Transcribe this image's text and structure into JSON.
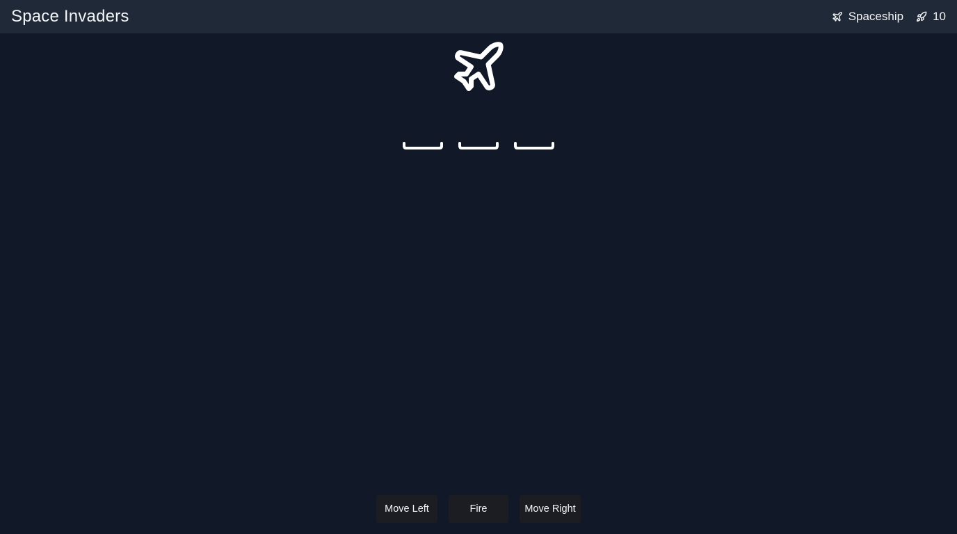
{
  "header": {
    "title": "Space Invaders",
    "ship_label": "Spaceship",
    "ship_icon": "plane-icon",
    "ammo_icon": "rocket-icon",
    "ammo_count": "10"
  },
  "game": {
    "player_icon": "plane-icon",
    "shield_count": 3,
    "colors": {
      "background": "#111827",
      "header": "#1f2937",
      "sprite": "#ffffff",
      "button": "#1c1d22"
    }
  },
  "controls": {
    "move_left": "Move Left",
    "fire": "Fire",
    "move_right": "Move Right"
  }
}
